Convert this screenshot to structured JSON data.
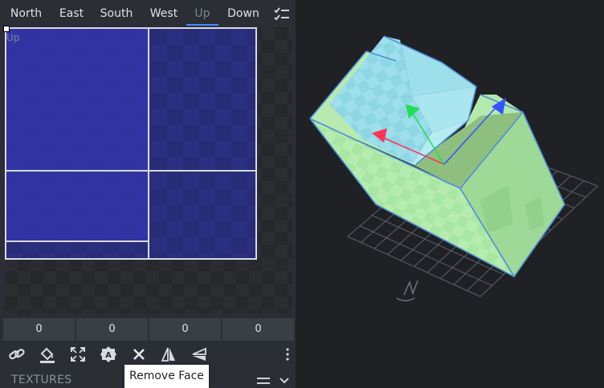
{
  "face_tabs": [
    {
      "label": "North",
      "active": false
    },
    {
      "label": "East",
      "active": false
    },
    {
      "label": "South",
      "active": false
    },
    {
      "label": "West",
      "active": false
    },
    {
      "label": "Up",
      "active": true
    },
    {
      "label": "Down",
      "active": false
    }
  ],
  "uv_editor": {
    "face_label": "Up",
    "inputs": [
      "0",
      "0",
      "0",
      "0"
    ]
  },
  "toolbar": {
    "buttons": [
      {
        "name": "link-icon"
      },
      {
        "name": "paint-bucket-icon"
      },
      {
        "name": "maximize-icon"
      },
      {
        "name": "auto-uv-icon"
      },
      {
        "name": "remove-face-icon"
      },
      {
        "name": "mirror-x-icon"
      },
      {
        "name": "mirror-y-icon"
      },
      {
        "name": "more-options-icon"
      }
    ],
    "tooltip": "Remove Face"
  },
  "textures_panel": {
    "title": "TEXTURES"
  },
  "colors": {
    "accent": "#3e90ff",
    "uv_texture": "#2b2f80",
    "cube_top": "#8fd8e6",
    "cube_side": "#a9e6a4",
    "axis_x": "#ff3355",
    "axis_y": "#22dd55",
    "axis_z": "#3355ff"
  }
}
